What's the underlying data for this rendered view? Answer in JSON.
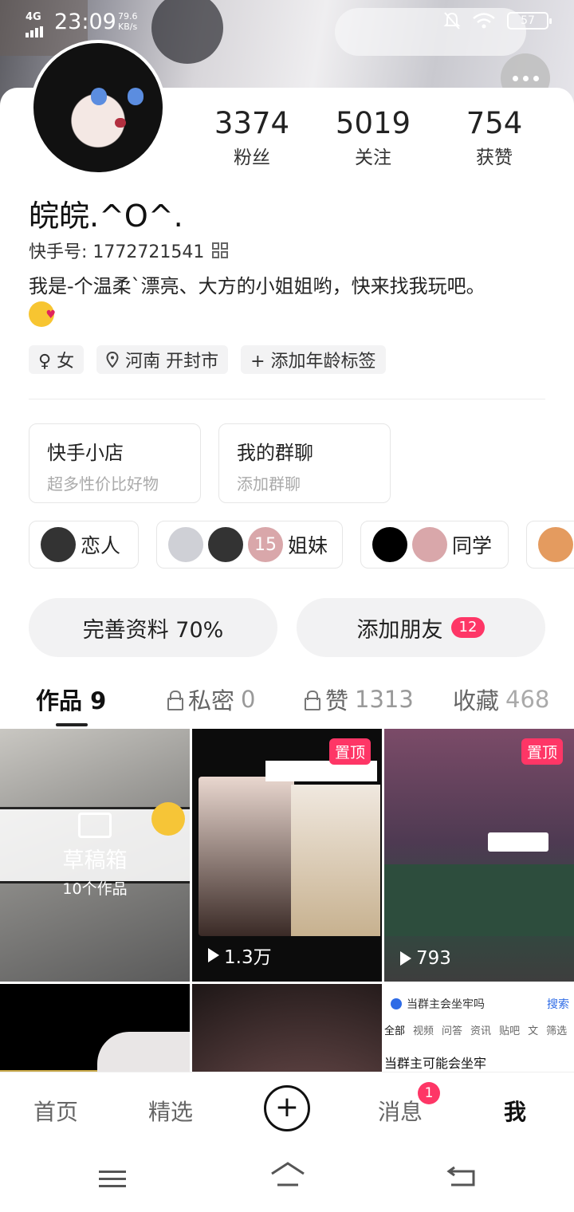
{
  "status_bar": {
    "network": "4G",
    "time": "23:09",
    "speed": "79.6 KB/s",
    "battery": "57"
  },
  "profile": {
    "followers_count": "3374",
    "followers_label": "粉丝",
    "following_count": "5019",
    "following_label": "关注",
    "likes_count": "754",
    "likes_label": "获赞",
    "nickname": "皖皖.^O^.",
    "kuaishou_id": "快手号: 1772721541",
    "bio": "我是-个温柔`漂亮、大方的小姐姐哟，快来找我玩吧。",
    "tags": [
      "♀ 女",
      "河南 开封市",
      "+ 添加年龄标签"
    ]
  },
  "cards": {
    "shop_title": "快手小店",
    "shop_sub": "超多性价比好物",
    "group_title": "我的群聊",
    "group_sub": "添加群聊"
  },
  "relations": {
    "lover": "恋人",
    "sisters_count": "15",
    "sisters": "姐妹",
    "classmates": "同学"
  },
  "actions": {
    "complete_profile": "完善资料 70%",
    "add_friends": "添加朋友",
    "add_friends_badge": "12"
  },
  "tabs": {
    "works": "作品 9",
    "private_label": "私密",
    "private_count": "0",
    "liked_label": "赞",
    "liked_count": "1313",
    "favorites_label": "收藏",
    "favorites_count": "468"
  },
  "grid": {
    "drafts_title": "草稿箱",
    "drafts_count": "10个作品",
    "pinned_label": "置顶",
    "video2_plays": "1.3万",
    "video3_plays": "793",
    "cell6_search": "当群主会坐牢吗",
    "cell6_search_btn": "搜索",
    "cell6_tabs": [
      "全部",
      "视频",
      "问答",
      "资讯",
      "贴吧",
      "文"
    ],
    "cell6_filter": "筛选",
    "cell6_result": "当群主可能会坐牢"
  },
  "bottom_nav": {
    "home": "首页",
    "featured": "精选",
    "messages": "消息",
    "messages_badge": "1",
    "me": "我"
  },
  "colors": {
    "accent": "#fe3666",
    "text": "#222222",
    "muted": "#aaaaaa"
  }
}
